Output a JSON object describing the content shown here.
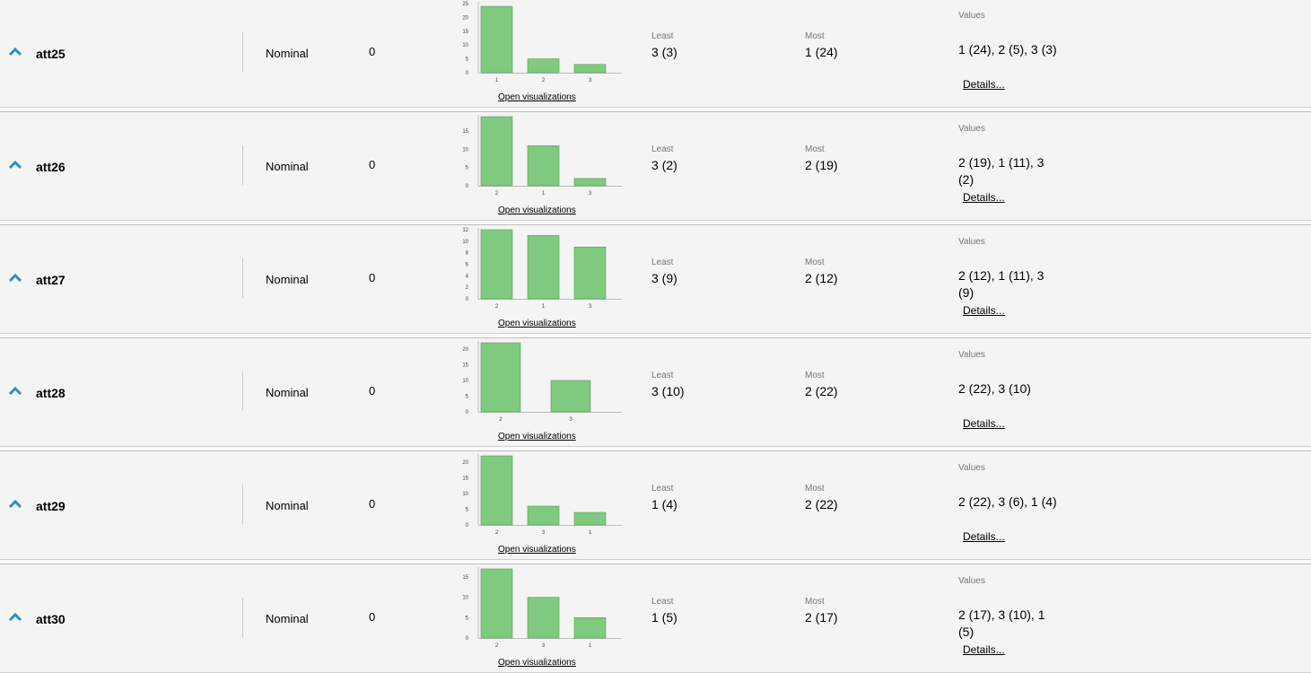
{
  "colors": {
    "bar_fill": "#7fca7e",
    "bar_stroke": "#5c9a5c",
    "chevron": "#2b8fc4",
    "background": "#f4f4f4"
  },
  "labels": {
    "least": "Least",
    "most": "Most",
    "values": "Values",
    "open_visualizations": "Open visualizations",
    "details": "Details..."
  },
  "attributes": [
    {
      "name": "att25",
      "type": "Nominal",
      "missing": "0",
      "least": "3 (3)",
      "most": "1 (24)",
      "values_text": "1 (24), 2 (5), 3 (3)",
      "chart_data": {
        "type": "bar",
        "categories": [
          "1",
          "2",
          "3"
        ],
        "values": [
          24,
          5,
          3
        ],
        "ylim": [
          0,
          25
        ],
        "yticks": [
          0,
          5,
          10,
          15,
          20,
          25
        ]
      }
    },
    {
      "name": "att26",
      "type": "Nominal",
      "missing": "0",
      "least": "3 (2)",
      "most": "2 (19)",
      "values_text": "2 (19), 1 (11), 3 (2)",
      "chart_data": {
        "type": "bar",
        "categories": [
          "2",
          "1",
          "3"
        ],
        "values": [
          19,
          11,
          2
        ],
        "ylim": [
          0,
          19
        ],
        "yticks": [
          0,
          5,
          10,
          15
        ]
      }
    },
    {
      "name": "att27",
      "type": "Nominal",
      "missing": "0",
      "least": "3 (9)",
      "most": "2 (12)",
      "values_text": "2 (12), 1 (11), 3 (9)",
      "chart_data": {
        "type": "bar",
        "categories": [
          "2",
          "1",
          "3"
        ],
        "values": [
          12,
          11,
          9
        ],
        "ylim": [
          0,
          12
        ],
        "yticks": [
          0,
          2,
          4,
          6,
          8,
          10,
          12
        ]
      }
    },
    {
      "name": "att28",
      "type": "Nominal",
      "missing": "0",
      "least": "3 (10)",
      "most": "2 (22)",
      "values_text": "2 (22), 3 (10)",
      "chart_data": {
        "type": "bar",
        "categories": [
          "2",
          "3"
        ],
        "values": [
          22,
          10
        ],
        "ylim": [
          0,
          22
        ],
        "yticks": [
          0,
          5,
          10,
          15,
          20
        ]
      }
    },
    {
      "name": "att29",
      "type": "Nominal",
      "missing": "0",
      "least": "1 (4)",
      "most": "2 (22)",
      "values_text": "2 (22), 3 (6), 1 (4)",
      "chart_data": {
        "type": "bar",
        "categories": [
          "2",
          "3",
          "1"
        ],
        "values": [
          22,
          6,
          4
        ],
        "ylim": [
          0,
          22
        ],
        "yticks": [
          0,
          5,
          10,
          15,
          20
        ]
      }
    },
    {
      "name": "att30",
      "type": "Nominal",
      "missing": "0",
      "least": "1 (5)",
      "most": "2 (17)",
      "values_text": "2 (17), 3 (10), 1 (5)",
      "chart_data": {
        "type": "bar",
        "categories": [
          "2",
          "3",
          "1"
        ],
        "values": [
          17,
          10,
          5
        ],
        "ylim": [
          0,
          17
        ],
        "yticks": [
          0,
          5,
          10,
          15
        ]
      }
    }
  ]
}
